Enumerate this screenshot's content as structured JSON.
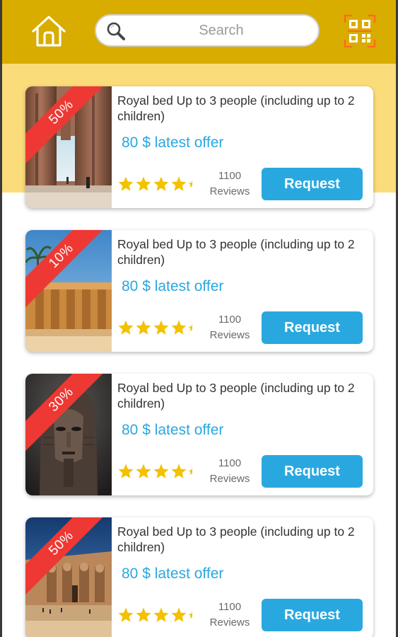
{
  "header": {
    "search": {
      "placeholder": "Search"
    },
    "colors": {
      "bar": "#d9ac00",
      "backdrop": "#fbdc7b"
    }
  },
  "cards": [
    {
      "discount": "50%",
      "title": "Royal bed Up to 3 people (including up to 2 children)",
      "offer": "80 $ latest offer",
      "rating": 4.5,
      "reviews_count": "1100",
      "reviews_label": "Reviews",
      "button_label": "Request",
      "image": "karnak-columns-photo"
    },
    {
      "discount": "10%",
      "title": "Royal bed Up to 3 people (including up to 2 children)",
      "offer": "80 $ latest offer",
      "rating": 4.5,
      "reviews_count": "1100",
      "reviews_label": "Reviews",
      "button_label": "Request",
      "image": "temple-colonnade-photo"
    },
    {
      "discount": "30%",
      "title": "Royal bed Up to 3 people (including up to 2 children)",
      "offer": "80 $ latest offer",
      "rating": 4.5,
      "reviews_count": "1100",
      "reviews_label": "Reviews",
      "button_label": "Request",
      "image": "pharaoh-statue-photo"
    },
    {
      "discount": "50%",
      "title": "Royal bed Up to 3 people (including up to 2 children)",
      "offer": "80 $ latest offer",
      "rating": 4.5,
      "reviews_count": "1100",
      "reviews_label": "Reviews",
      "button_label": "Request",
      "image": "abu-simbel-photo"
    }
  ],
  "accent_colors": {
    "ribbon": "#ee3833",
    "offer_text": "#2aa7df",
    "button": "#29a8e0",
    "star": "#f2c200"
  }
}
